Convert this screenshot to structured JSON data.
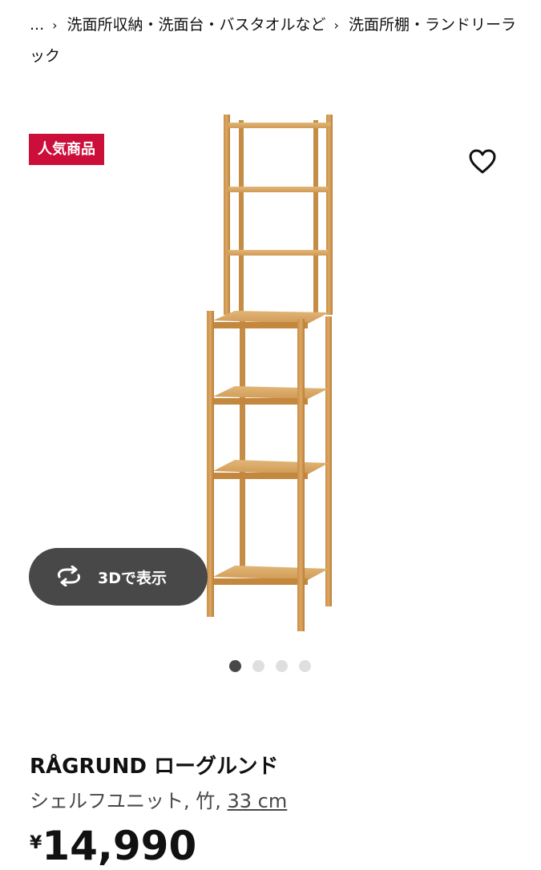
{
  "breadcrumb": {
    "ellipsis": "...",
    "separator": "›",
    "items": [
      {
        "label": "洗面所収納・洗面台・バスタオルなど"
      },
      {
        "label": "洗面所棚・ランドリーラック"
      }
    ]
  },
  "badge": {
    "label": "人気商品",
    "color": "#cc0e3a"
  },
  "favorite": {
    "icon": "heart-outline-icon"
  },
  "viewer3d": {
    "label": "3Dで表示",
    "icon": "rotate-arrows-icon"
  },
  "carousel": {
    "count": 4,
    "active_index": 0
  },
  "product": {
    "name": "RÅGRUND ローグルンド",
    "description_prefix": "シェルフユニット, 竹, ",
    "size": "33 cm",
    "currency": "¥",
    "price": "14,990"
  }
}
